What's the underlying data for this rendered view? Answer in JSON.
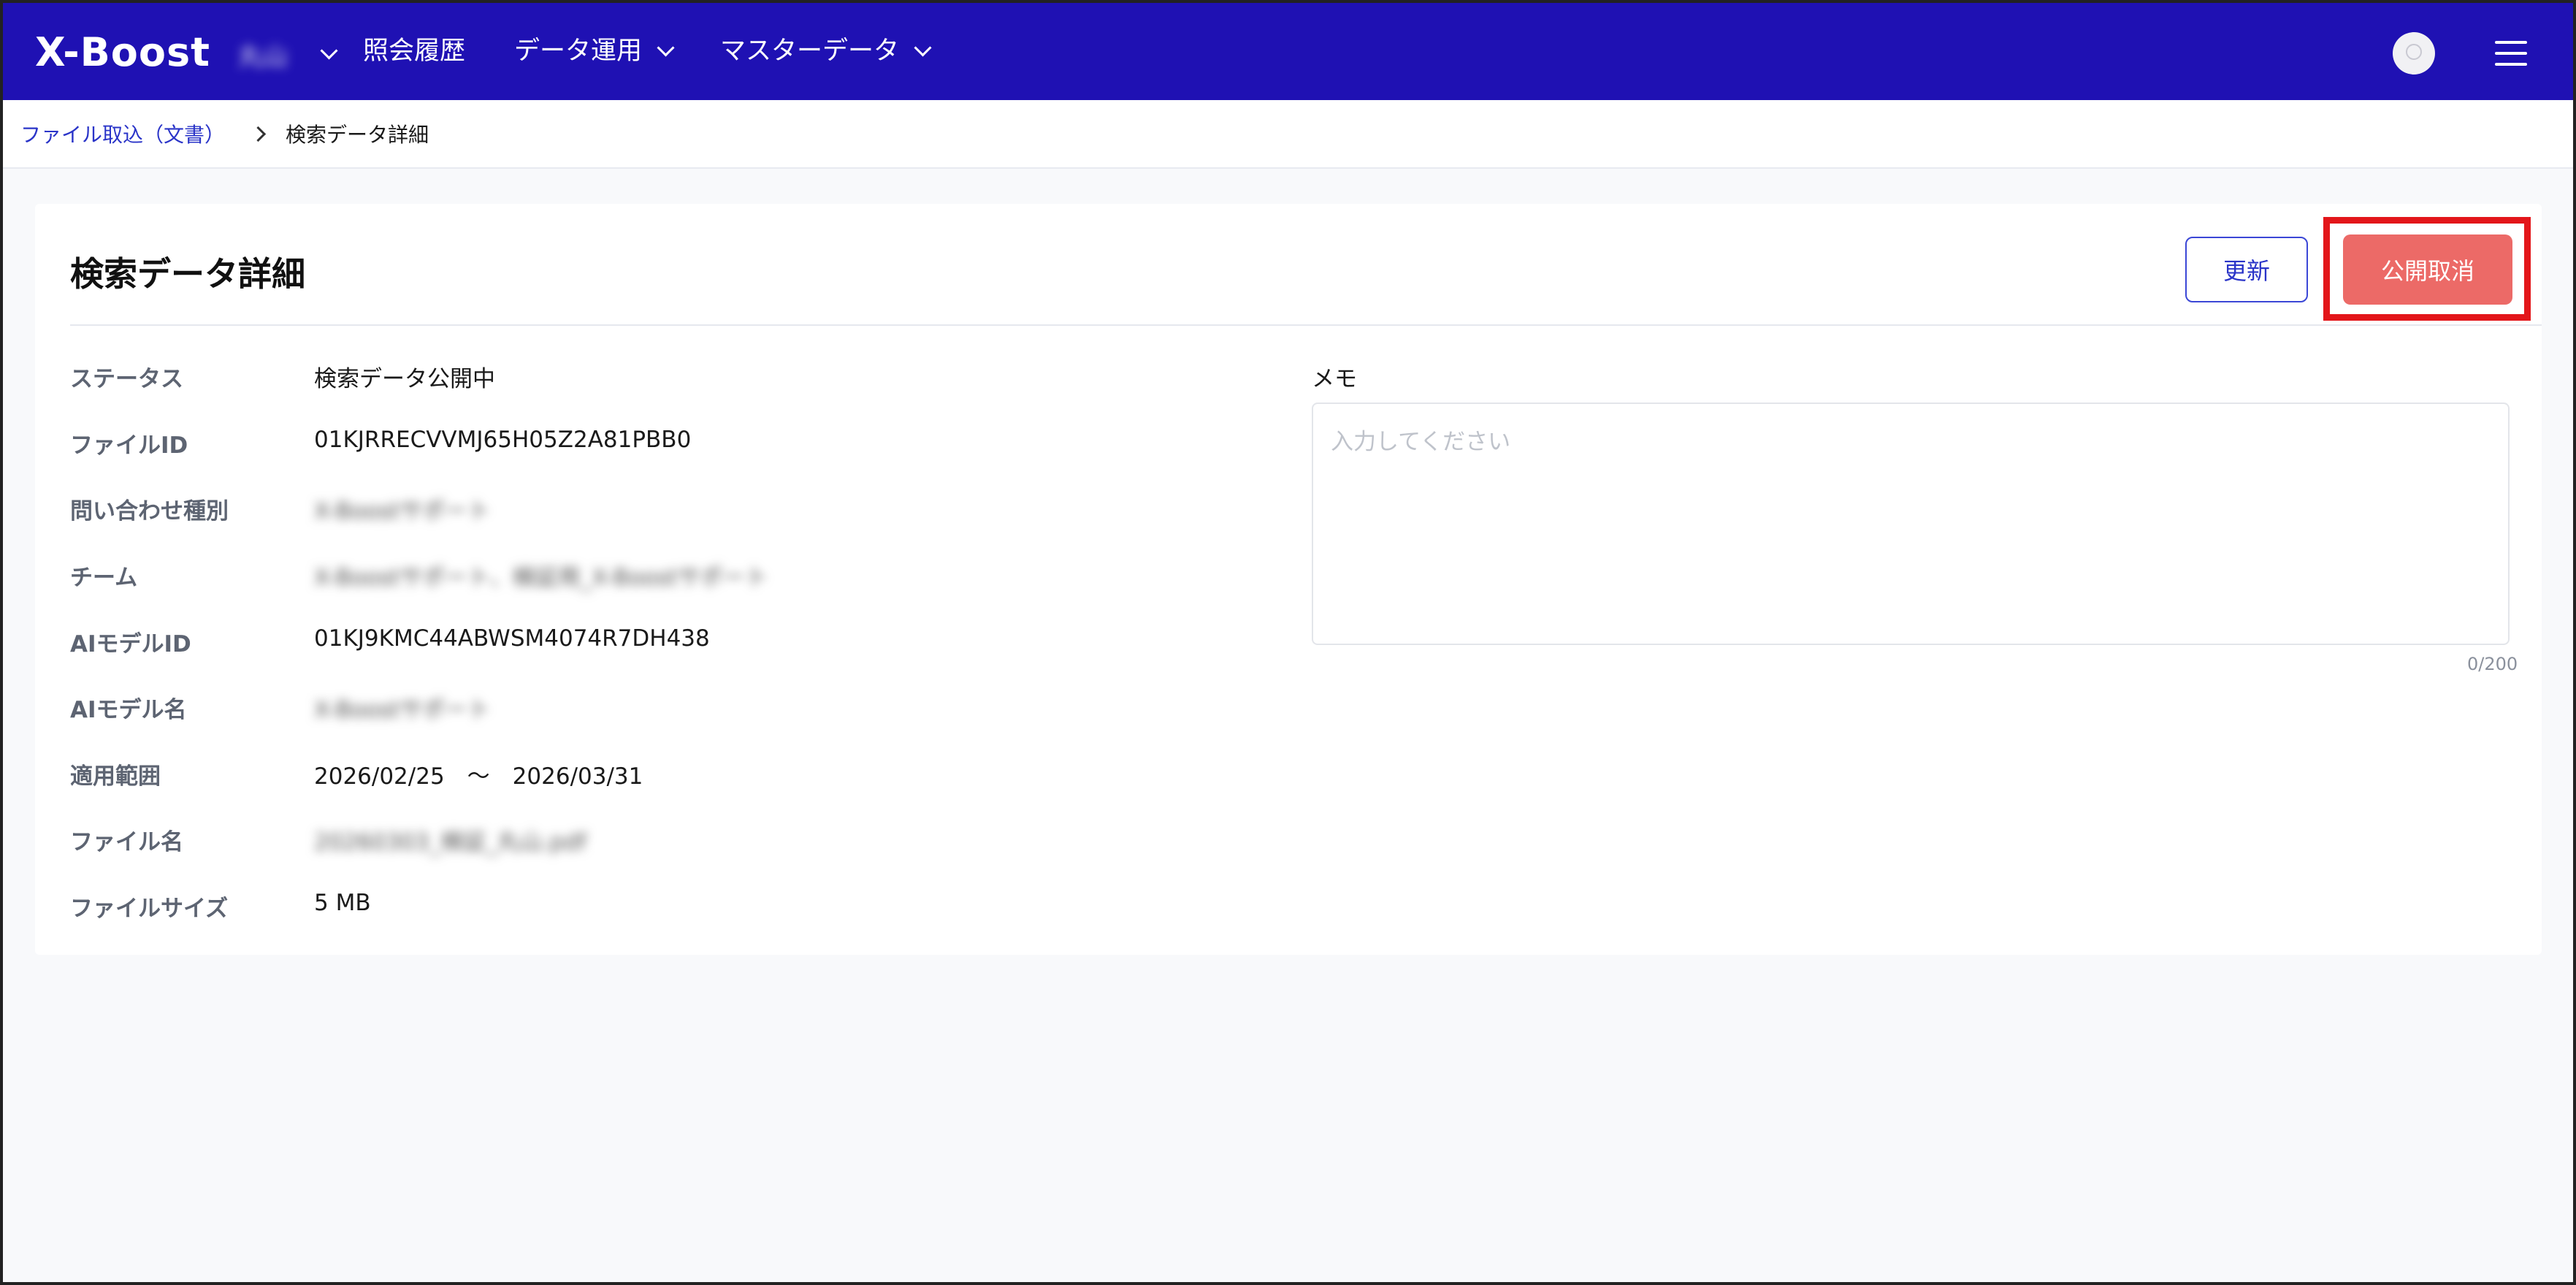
{
  "header": {
    "logo": "X-Boost",
    "tenant": "丸山",
    "nav": [
      {
        "label": "照会履歴",
        "has_dropdown": false
      },
      {
        "label": "データ運用",
        "has_dropdown": true
      },
      {
        "label": "マスターデータ",
        "has_dropdown": true
      }
    ],
    "icons": {
      "avatar": "user-avatar-icon",
      "menu": "hamburger-icon"
    },
    "bg_color": "#1f11b3"
  },
  "breadcrumb": {
    "parent": "ファイル取込（文書）",
    "current": "検索データ詳細"
  },
  "card": {
    "title": "検索データ詳細",
    "buttons": {
      "update": "更新",
      "unpublish": "公開取消"
    },
    "fields": [
      {
        "label": "ステータス",
        "value": "検索データ公開中",
        "blurred": false
      },
      {
        "label": "ファイルID",
        "value": "01KJRRECVVMJ65H05Z2A81PBB0",
        "blurred": false
      },
      {
        "label": "問い合わせ種別",
        "value": "X-Boostサポート",
        "blurred": true
      },
      {
        "label": "チーム",
        "value": "X-Boostサポート、検証用_X-Boostサポート",
        "blurred": true
      },
      {
        "label": "AIモデルID",
        "value": "01KJ9KMC44ABWSM4074R7DH438",
        "blurred": false
      },
      {
        "label": "AIモデル名",
        "value": "X-Boostサポート",
        "blurred": true
      },
      {
        "label": "適用範囲",
        "value": "2026/02/25　～　2026/03/31",
        "blurred": false
      },
      {
        "label": "ファイル名",
        "value": "20260303_検証_丸山.pdf",
        "blurred": true
      },
      {
        "label": "ファイルサイズ",
        "value": "5 MB",
        "blurred": false
      }
    ],
    "memo": {
      "label": "メモ",
      "placeholder": "入力してください",
      "value": "",
      "counter": "0/200"
    }
  },
  "colors": {
    "accent": "#2a34c8",
    "danger": "#ec6a67",
    "highlight": "#e3161a"
  }
}
